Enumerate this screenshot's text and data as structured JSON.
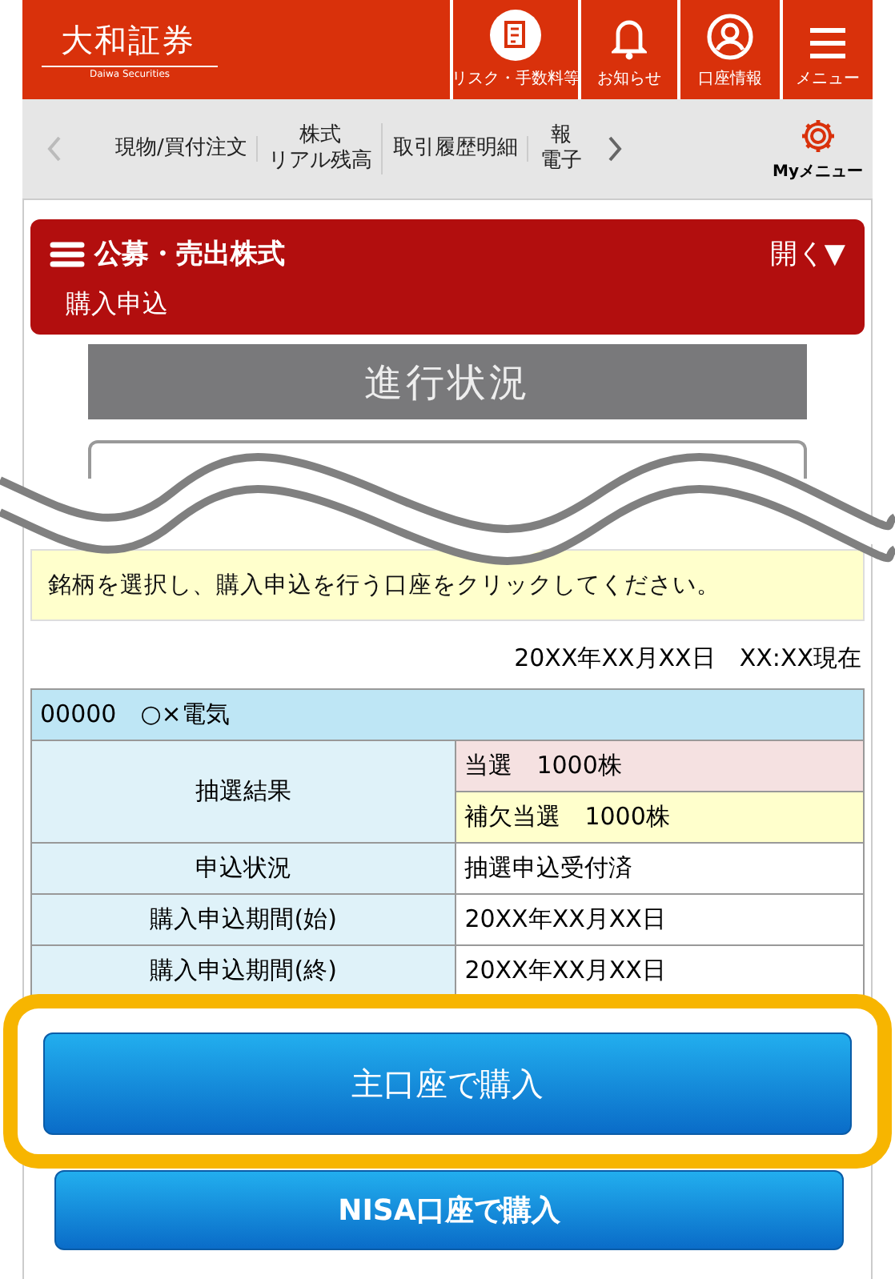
{
  "header": {
    "logo": "大和証券",
    "logo_sub": "Daiwa Securities",
    "actions": [
      {
        "kind": "risk",
        "label": "リスク・手数料等"
      },
      {
        "kind": "bell",
        "label": "お知らせ"
      },
      {
        "kind": "account",
        "label": "口座情報"
      },
      {
        "kind": "menu",
        "label": "メニュー"
      }
    ]
  },
  "nav": {
    "items": [
      [
        "現物/買付注文"
      ],
      [
        "株式",
        "リアル残高"
      ],
      [
        "取引履歴明細"
      ],
      [
        "報",
        "電子"
      ]
    ],
    "my_menu": "Myメニュー"
  },
  "section": {
    "title": "公募・売出株式",
    "toggle": "開く▼",
    "subtitle": "購入申込"
  },
  "progress": {
    "title": "進行状況"
  },
  "notice": "銘柄を選択し、購入申込を行う口座をクリックしてください。",
  "as_of": "20XX年XX月XX日　XX:XX現在",
  "stock": {
    "header": "00000　○×電気",
    "rows": [
      {
        "label": "抽選結果",
        "values": [
          {
            "text": "当選　1000株",
            "color": "#f5e1e1"
          },
          {
            "text": "補欠当選　1000株",
            "color": "#ffffcc"
          }
        ]
      },
      {
        "label": "申込状況",
        "values": [
          {
            "text": "抽選申込受付済",
            "color": "#ffffff"
          }
        ]
      },
      {
        "label": "購入申込期間(始)",
        "values": [
          {
            "text": "20XX年XX月XX日",
            "color": "#ffffff"
          }
        ]
      },
      {
        "label": "購入申込期間(終)",
        "values": [
          {
            "text": "20XX年XX月XX日",
            "color": "#ffffff"
          }
        ]
      }
    ]
  },
  "buttons": [
    {
      "label": "主口座で購入",
      "highlighted": true
    },
    {
      "label": "NISA口座で購入",
      "highlighted": false
    }
  ]
}
